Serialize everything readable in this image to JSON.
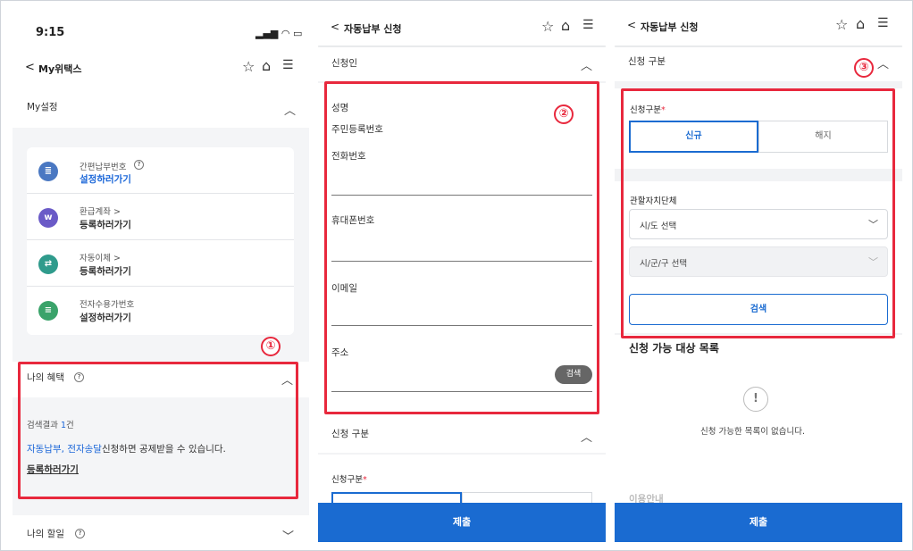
{
  "panel1": {
    "status_time": "9:15",
    "status_icons": "signal wifi battery",
    "header_back": "<",
    "header_title": "My위택스",
    "star_icon": "☆",
    "home_icon": "⌂",
    "menu_icon": "☰",
    "my_settings_title": "My설정",
    "collapse_icon": "^",
    "items": [
      {
        "title": "간편납부번호",
        "help": "?",
        "link": "설정하러가기",
        "link_color": "#1a66d8",
        "icon": "doc-icon",
        "icon_color": "#4a78c2",
        "icon_glyph": "≣"
      },
      {
        "title": "환급계좌 >",
        "help": "",
        "link": "등록하러가기",
        "link_color": "#222",
        "icon": "won-icon",
        "icon_color": "#6a5ac7",
        "icon_glyph": "w"
      },
      {
        "title": "자동이체 >",
        "help": "",
        "link": "등록하러가기",
        "link_color": "#222",
        "icon": "transfer-icon",
        "icon_color": "#2f9b8c",
        "icon_glyph": "⇄"
      },
      {
        "title": "전자수용가번호",
        "help": "",
        "link": "설정하러가기",
        "link_color": "#222",
        "icon": "clipboard-icon",
        "icon_color": "#3aa36a",
        "icon_glyph": "≡"
      }
    ],
    "marker": "①",
    "benefit_title": "나의 혜택",
    "help": "?",
    "result_prefix": "검색결과 ",
    "result_count": "1",
    "result_suffix": "건",
    "benefit_blue": "자동납부, 전자송달",
    "benefit_text": "신청하면 공제받을 수 있습니다.",
    "register_link": "등록하러가기",
    "todo_title": "나의 할일"
  },
  "panel2": {
    "header_back": "<",
    "header_title": "자동납부 신청",
    "section_applicant": "신청인",
    "marker": "②",
    "name_label": "성명",
    "rrn_label": "주민등록번호",
    "phone_label": "전화번호",
    "mobile_label": "휴대폰번호",
    "email_label": "이메일",
    "address_label": "주소",
    "search_button": "검색",
    "section_type": "신청 구분",
    "type_label": "신청구분",
    "required": "*",
    "submit": "제출"
  },
  "panel3": {
    "header_back": "<",
    "header_title": "자동납부 신청",
    "section_type": "신청 구분",
    "marker": "③",
    "type_label": "신청구분",
    "required": "*",
    "tab_new": "신규",
    "tab_cancel": "해지",
    "region_label": "관할자치단체",
    "sido_select": "시/도 선택",
    "sigungu_select": "시/군/구 선택",
    "search_button": "검색",
    "list_title": "신청 가능 대상 목록",
    "empty_icon": "!",
    "empty_text": "신청 가능한 목록이 없습니다.",
    "cutoff_text": "이용안내",
    "submit": "제출"
  }
}
